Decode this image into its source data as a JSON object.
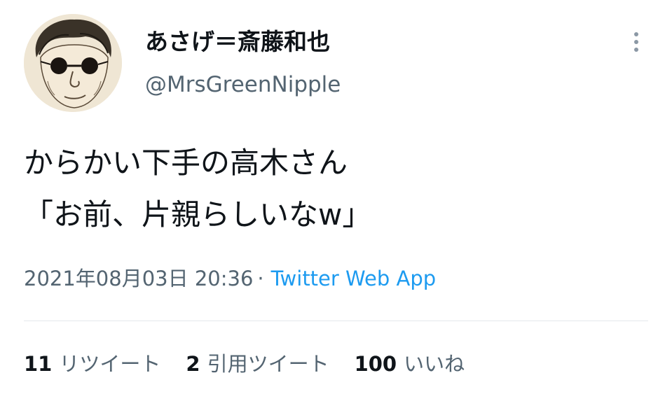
{
  "author": {
    "display_name": "あさげ＝斎藤和也",
    "handle": "@MrsGreenNipple",
    "avatar_icon": "avatar-icon"
  },
  "more_icon": "more-vertical-icon",
  "tweet": {
    "lines": [
      "からかい下手の高木さん",
      "「お前、片親らしいなw」"
    ]
  },
  "meta": {
    "timestamp": "2021年08月03日 20:36",
    "separator": "·",
    "source": "Twitter Web App"
  },
  "stats": {
    "retweets": {
      "count": "11",
      "label": "リツイート"
    },
    "quotes": {
      "count": "2",
      "label": "引用ツイート"
    },
    "likes": {
      "count": "100",
      "label": "いいね"
    }
  },
  "colors": {
    "text": "#0f1419",
    "secondary": "#536471",
    "link": "#1d9bf0",
    "divider": "#e3e8ec"
  }
}
